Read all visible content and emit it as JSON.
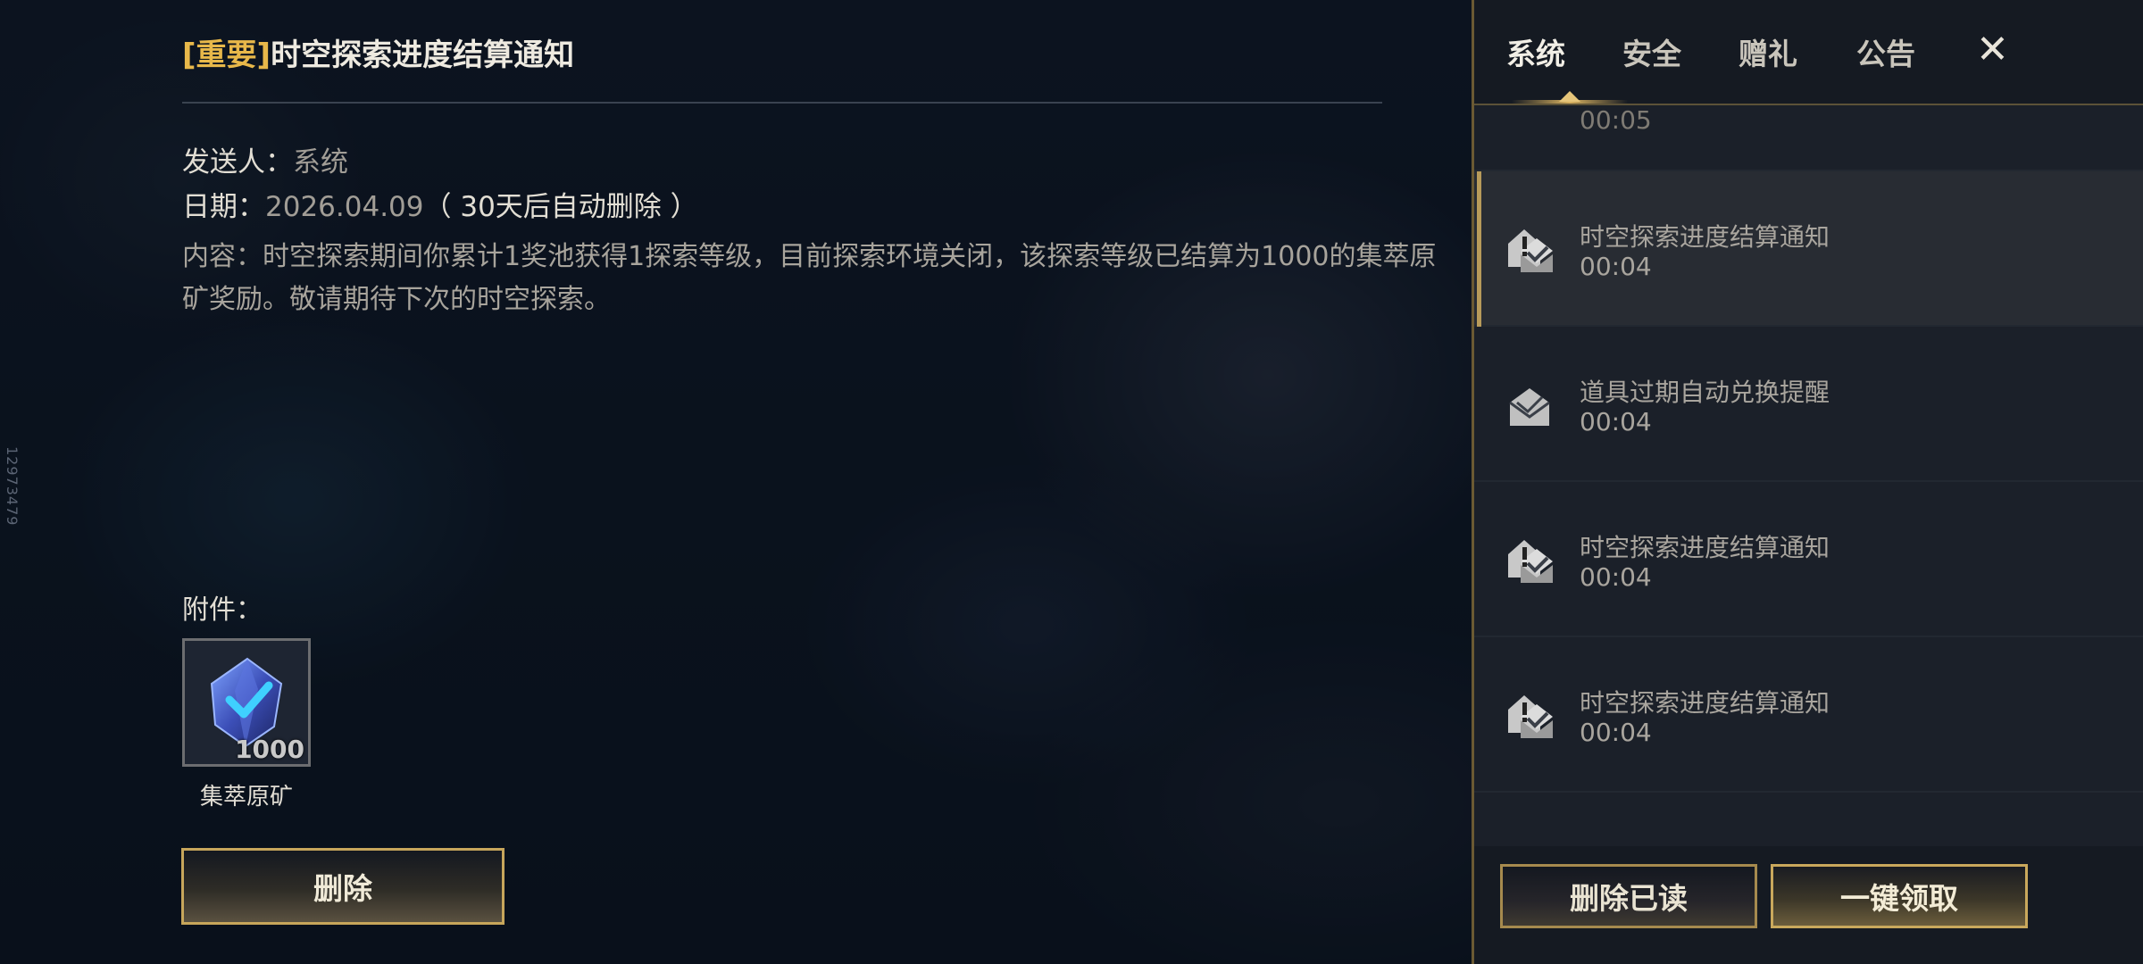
{
  "side_id": "12973479",
  "detail": {
    "title_tag": "[重要]",
    "title": "时空探索进度结算通知",
    "sender_label": "发送人：",
    "sender_value": "系统",
    "date_label": "日期：",
    "date_value": "2026.04.09",
    "date_note": "（ 30天后自动删除 ）",
    "content_label": "内容：",
    "content_text": "时空探索期间你累计1奖池获得1探索等级，目前探索环境关闭，该探索等级已结算为1000的集萃原矿奖励。敬请期待下次的时空探索。",
    "attachment_label": "附件：",
    "attachment": {
      "name": "集萃原矿",
      "count": "1000",
      "icon": "crystal-ore-icon"
    },
    "delete_button": "删除"
  },
  "tabs": [
    {
      "label": "系统",
      "active": true
    },
    {
      "label": "安全",
      "active": false
    },
    {
      "label": "赠礼",
      "active": false
    },
    {
      "label": "公告",
      "active": false
    }
  ],
  "close_glyph": "✕",
  "mail_list": {
    "partial_top_time": "00:05",
    "items": [
      {
        "title": "时空探索进度结算通知",
        "time": "00:04",
        "icon": "important-mail-icon",
        "selected": true
      },
      {
        "title": "道具过期自动兑换提醒",
        "time": "00:04",
        "icon": "mail-icon",
        "selected": false
      },
      {
        "title": "时空探索进度结算通知",
        "time": "00:04",
        "icon": "important-mail-icon",
        "selected": false
      },
      {
        "title": "时空探索进度结算通知",
        "time": "00:04",
        "icon": "important-mail-icon",
        "selected": false
      }
    ]
  },
  "footer": {
    "delete_read": "删除已读",
    "claim_all": "一键领取"
  },
  "colors": {
    "accent_gold": "#e8b84a",
    "border_gold": "#c7a65b",
    "panel_bg": "#151a22"
  }
}
